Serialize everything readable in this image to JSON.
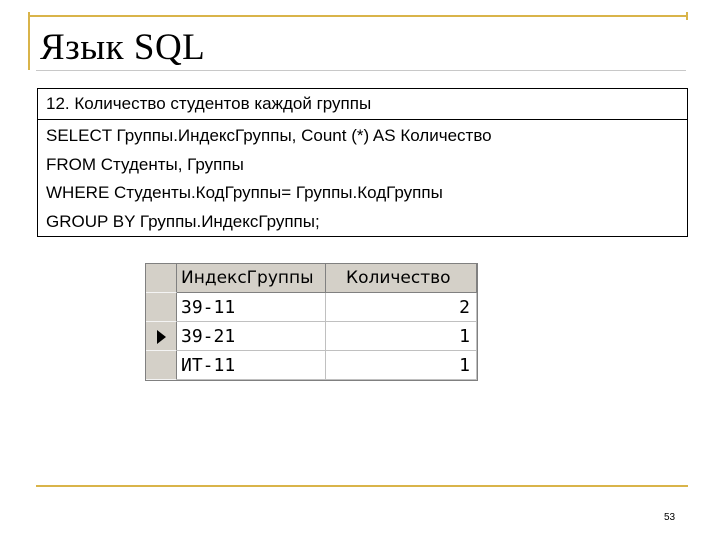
{
  "slide": {
    "title": "Язык SQL",
    "box_header": "12. Количество студентов каждой группы",
    "sql_lines": [
      "SELECT Группы.ИндексГруппы, Count (*) AS Количество",
      "FROM Студенты, Группы",
      "WHERE Студенты.КодГруппы= Группы.КодГруппы",
      "GROUP BY Группы.ИндексГруппы;"
    ],
    "page_number": "53"
  },
  "result_grid": {
    "columns": [
      "ИндексГруппы",
      "Количество"
    ],
    "rows": [
      {
        "group_index": "39-11",
        "count": "2",
        "current": false
      },
      {
        "group_index": "39-21",
        "count": "1",
        "current": true
      },
      {
        "group_index": "ИТ-11",
        "count": "1",
        "current": false
      }
    ]
  },
  "colors": {
    "accent_line": "#d9b44a",
    "grid_header": "#d4d0c8"
  }
}
